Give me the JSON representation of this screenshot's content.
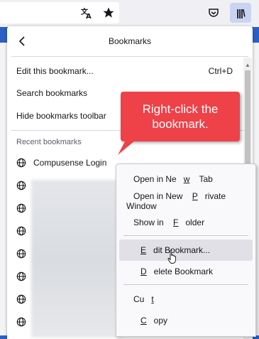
{
  "toolbar": {
    "translate_icon": "translate-icon",
    "bookmark_star_icon": "star-icon",
    "pocket_icon": "pocket-icon",
    "library_icon": "library-icon",
    "library_glyph": "|||\\"
  },
  "panel": {
    "title": "Bookmarks",
    "back_glyph": "‹",
    "menu": [
      {
        "label": "Edit this bookmark...",
        "shortcut": "Ctrl+D"
      },
      {
        "label": "Search bookmarks",
        "shortcut": ""
      },
      {
        "label": "Hide bookmarks toolbar",
        "shortcut": ""
      }
    ],
    "recent_label": "Recent bookmarks",
    "recent": [
      {
        "label": "Compusense Login"
      }
    ]
  },
  "callout": {
    "line1": "Right-click the",
    "line2": "bookmark.",
    "color": "#ee4148"
  },
  "context_menu": {
    "items": [
      {
        "pre": "Open in Ne",
        "u": "w",
        "post": " Tab"
      },
      {
        "pre": "Open in New ",
        "u": "P",
        "post": "rivate Window"
      },
      {
        "pre": "Show in ",
        "u": "F",
        "post": "older"
      },
      {
        "pre": "",
        "u": "E",
        "post": "dit Bookmark..."
      },
      {
        "pre": "",
        "u": "D",
        "post": "elete Bookmark"
      },
      {
        "pre": "Cu",
        "u": "t",
        "post": ""
      },
      {
        "pre": "",
        "u": "C",
        "post": "opy"
      }
    ],
    "highlighted_index": 3
  },
  "colors": {
    "accent": "#2c5fc4",
    "callout": "#ee4148",
    "menu_highlight": "#e0e0e6"
  }
}
